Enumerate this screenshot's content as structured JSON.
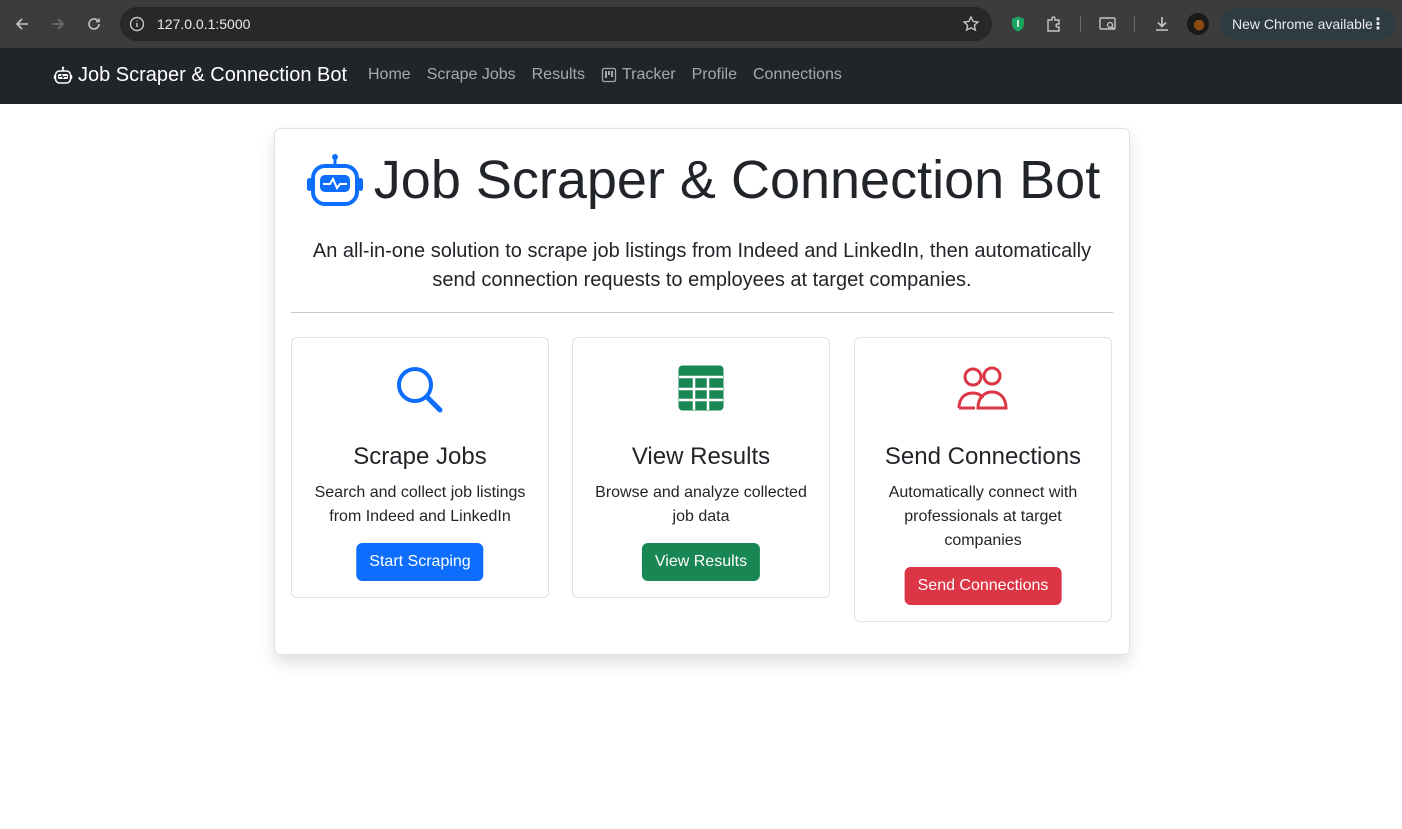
{
  "browser": {
    "url": "127.0.0.1:5000",
    "update_label": "New Chrome available"
  },
  "navbar": {
    "brand": "Job Scraper & Connection Bot",
    "links": [
      "Home",
      "Scrape Jobs",
      "Results",
      "Tracker",
      "Profile",
      "Connections"
    ]
  },
  "hero": {
    "title": "Job Scraper & Connection Bot",
    "lead": "An all-in-one solution to scrape job listings from Indeed and LinkedIn, then automatically send connection requests to employees at target companies."
  },
  "features": [
    {
      "icon": "search-icon",
      "title": "Scrape Jobs",
      "description": "Search and collect job listings from Indeed and LinkedIn",
      "button": "Start Scraping",
      "color": "#0d6efd"
    },
    {
      "icon": "table-icon",
      "title": "View Results",
      "description": "Browse and analyze collected job data",
      "button": "View Results",
      "color": "#198754"
    },
    {
      "icon": "people-icon",
      "title": "Send Connections",
      "description": "Automatically connect with professionals at target companies",
      "button": "Send Connections",
      "color": "#dc3545"
    }
  ]
}
